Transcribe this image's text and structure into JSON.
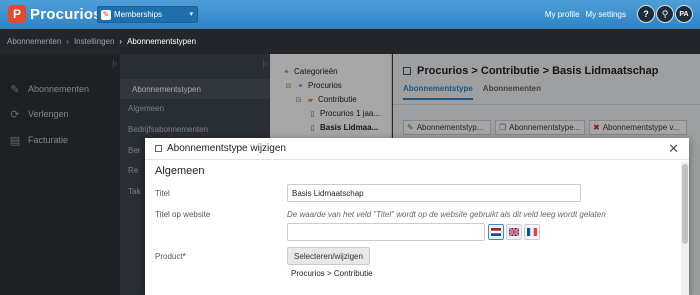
{
  "app": {
    "name": "Procurios",
    "logo_letter": "P"
  },
  "module_selector": {
    "label": "Memberships"
  },
  "top_links": {
    "profile": "My profile",
    "settings": "My settings",
    "help": "?",
    "search": "⚲",
    "avatar": "PA"
  },
  "breadcrumb": {
    "items": [
      "Abonnementen",
      "Instellingen"
    ],
    "current": "Abonnementstypen"
  },
  "left_nav": {
    "items": [
      {
        "label": "Abonnementen",
        "icon": "pencil-square-icon"
      },
      {
        "label": "Verlengen",
        "icon": "refresh-icon"
      },
      {
        "label": "Facturatie",
        "icon": "document-icon"
      }
    ]
  },
  "sub_nav": {
    "items": [
      "Abonnementstypen",
      "Algemeen",
      "Bedrijfsabonnementen",
      "Ber",
      "Re",
      "Tak"
    ]
  },
  "tree": {
    "root": "Categorieën",
    "procurios": "Procurios",
    "contributie": "Contributie",
    "child1": "Procurios 1 jaa...",
    "child2": "Basis Lidmaa..."
  },
  "main": {
    "title": "Procurios > Contributie > Basis Lidmaatschap",
    "tabs": [
      "Abonnementstype",
      "Abonnementen"
    ],
    "cards": [
      "Abonnementstyp...",
      "Abonnementstype...",
      "Abonnementstype v..."
    ]
  },
  "modal": {
    "title": "Abonnementstype wijzigen",
    "section": "Algemeen",
    "titel_label": "Titel",
    "titel_value": "Basis Lidmaatschap",
    "website_label": "Titel op website",
    "website_hint": "De waarde van het veld \"Titel\" wordt op de website gebruikt als dit veld leeg wordt gelaten",
    "website_value": "",
    "product_label": "Product",
    "product_required": "*",
    "select_button": "Selecteren/wijzigen",
    "product_value": "Procurios > Contributie"
  }
}
